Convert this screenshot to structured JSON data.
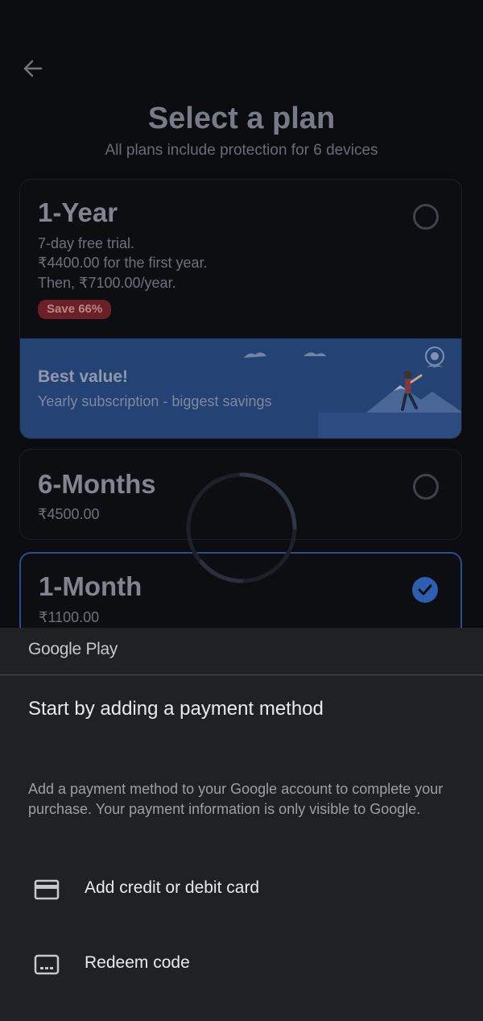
{
  "header": {
    "title": "Select a plan",
    "subtitle": "All plans include protection for 6 devices"
  },
  "plans": [
    {
      "name": "1-Year",
      "lines": [
        "7-day free trial.",
        "₹4400.00 for the first year.",
        "Then, ₹7100.00/year."
      ],
      "badge": "Save 66%",
      "banner_title": "Best value!",
      "banner_subtitle": "Yearly subscription - biggest savings",
      "selected": false
    },
    {
      "name": "6-Months",
      "price": "₹4500.00",
      "selected": false
    },
    {
      "name": "1-Month",
      "price": "₹1100.00",
      "selected": true
    }
  ],
  "google_play": {
    "brand": "Google Play",
    "title": "Start by adding a payment method",
    "description": "Add a payment method to your Google account to complete your purchase. Your payment information is only visible to Google.",
    "options": [
      {
        "label": "Add credit or debit card",
        "icon": "credit-card-icon"
      },
      {
        "label": "Redeem code",
        "icon": "redeem-code-icon"
      }
    ]
  },
  "colors": {
    "background": "#0b0c0f",
    "accent_blue": "#2d5eb0",
    "banner_blue": "#244273",
    "badge_red": "#6b1f27",
    "sheet_background": "#202124"
  }
}
